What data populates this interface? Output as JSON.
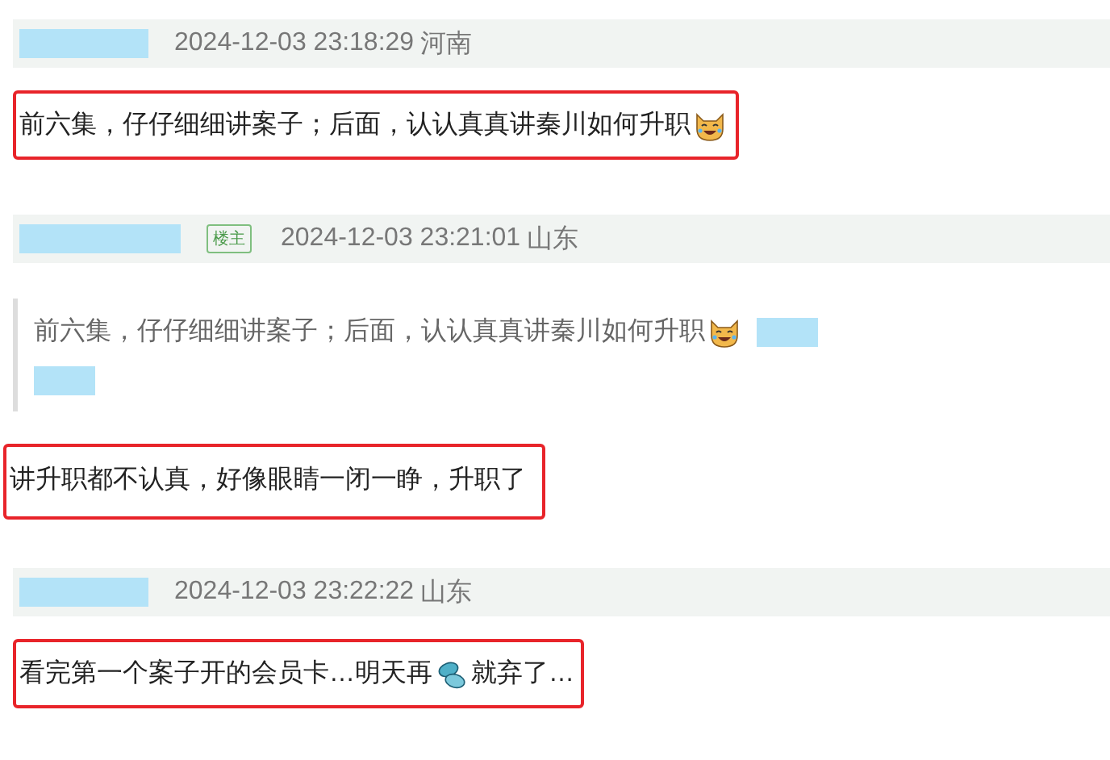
{
  "comments": [
    {
      "author": {
        "redacted": true
      },
      "time": "2024-12-03 23:18:29",
      "location": "河南",
      "highlighted": true,
      "body": [
        {
          "kind": "text",
          "text": "前六集，仔仔细细讲案子；后面，认认真真讲秦川如何升职"
        },
        {
          "kind": "laugh-icon"
        }
      ]
    },
    {
      "author": {
        "redacted": true
      },
      "badge": "楼主",
      "time": "2024-12-03 23:21:01",
      "location": "山东",
      "quote": {
        "parts": [
          {
            "kind": "text",
            "text": "前六集，仔仔细细讲案子；后面，认认真真讲秦川如何升职"
          },
          {
            "kind": "laugh-icon"
          },
          {
            "kind": "redacted"
          },
          {
            "kind": "break"
          },
          {
            "kind": "redacted"
          }
        ]
      },
      "highlighted": true,
      "body": [
        {
          "kind": "text",
          "text": "讲升职都不认真，好像眼睛一闭一睁，升职了"
        }
      ]
    },
    {
      "author": {
        "redacted": true
      },
      "time": "2024-12-03 23:22:22",
      "location": "山东",
      "highlighted": true,
      "body": [
        {
          "kind": "text",
          "text": "看完第一个案子开的会员卡…明天再"
        },
        {
          "kind": "pill-icon"
        },
        {
          "kind": "text",
          "text": "就弃了…"
        }
      ]
    }
  ]
}
